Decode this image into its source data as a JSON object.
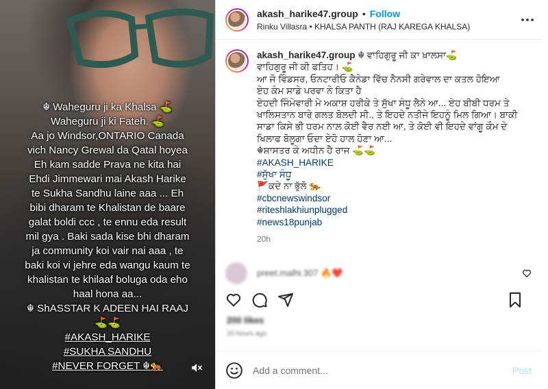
{
  "media": {
    "caption_lines": [
      "☬ Waheguru ji ka Khalsa ⛳",
      "Waheguru ji ki Fateh. ⛳",
      "Aa jo Windsor,ONTARIO Canada",
      "vich Nancy Grewal da Qatal hoyea",
      "Eh kam sadde Prava ne kita hai",
      "Ehdi Jimmewari mai Akash Harike",
      "te Sukha Sandhu  laine aaa ... Eh",
      "bibi dharam te Khalistan de baare",
      "galat boldi ccc , te ennu eda result",
      "mil gya . Baki sada kise bhi dharam",
      "ja community koi vair nai aaa , te",
      "baki koi vi jehre eda wangu kaum te",
      "khalistan te khilaaf boluga oda eho",
      "haal hona aa...",
      "☬ ShASSTAR K ADEEN HAI RAAJ",
      "⛳⛳"
    ],
    "caption_tags": [
      "#AKASH_HARIKE",
      "#SUKHA SANDHU",
      "#NEVER FORGET ☬🐅"
    ],
    "mute_icon": "speaker-muted-icon"
  },
  "header": {
    "username": "akash_harike47.group",
    "separator": "•",
    "follow_label": "Follow",
    "subtitle": "Rinku Villasra • KHALSA PANTH (RAJ KAREGA KHALSA)"
  },
  "post": {
    "username": "akash_harike47.group",
    "first_line": " ☬ ਵਾਹਿਗੁਰੂ ਜੀ ਕਾ ਖ਼ਾਲਸਾ⛳",
    "lines": [
      "ਵਾਹਿਗੁਰੂ ਜੀ ਕੀ ਫਤਿਹ। ⛳",
      "ਆ ਜੋ ਵਿੰਡਸਰ, ਓਨਟਾਰੀਓ ਕੈਨੇਡਾ ਵਿੱਚ ਨੈਨਸੀ ਗਰੇਵਾਲ ਦਾ ਕਤਲ ਹੋਇਆ",
      "ਏਹ ਕੰਮ ਸਾਡੇ ਪਰਵਾ ਨੇ ਕਿਤਾ ਹੈ",
      "ਏਹਦੀ ਜਿੰਮੇਵਾਰੀ ਮੇ ਅਕਾਸ਼ ਹਰੀਕੇ ਤੇ ਸੁੱਖਾ ਸੰਧੂ ਲੈਨੇ ਆ... ਏਹ ਬੀਬੀ ਧਰਮ ਤੇ",
      "ਖਾਲਿਸਤਾਨ ਬਾਰੇ ਗਲਤ ਬੋਲਦੀ ਸੀ., ਤੇ ਇਹਦੇ ਨਤੀਜੇ ਇਹਨੂੰ ਮਿਲ ਗਿਆ। ਬਾਕੀ",
      "ਸਾਡਾ ਕਿਸੇ ਭੀ ਧਰਮ ਨਾਲ਼ ਕੋਈ ਵੈਰ ਨਈ ਆ, ਤੇ ਕੋਈ ਵੀ ਇਹਦੇ ਵਾਂਗੂ ਕੌਮ ਦੇ",
      "ਖਿਲਾਫ ਬੋਲੂਗਾ ਓਦਾ ਏਹੋ ਹਾਲ ਹੋਣਾ ਆ...",
      "☬ਸ਼ਾਸਤਰ ਕੇ ਅਧੀਨ ਹੈ ਰਾਜ ⛳⛳"
    ],
    "hashtags": [
      "#AKASH_HARIKE",
      "#ਸੁੱਖਾ ਸੰਧੂ"
    ],
    "never_forget": "🚩ਕਦੇ ਨਾ ਭੁੱਲੋ 🐅",
    "more_hashtags": [
      "#cbcnewswindsor",
      "#riteshlakhiunplugged",
      "#news18punjab"
    ],
    "time": "20h"
  },
  "blurred_comment": {
    "text": "preet.malhi.307 🔥❤️"
  },
  "likes_blur": "200 likes",
  "date_blur": "20 hours ago",
  "comment_box": {
    "placeholder": "Add a comment...",
    "post_label": "Post"
  }
}
